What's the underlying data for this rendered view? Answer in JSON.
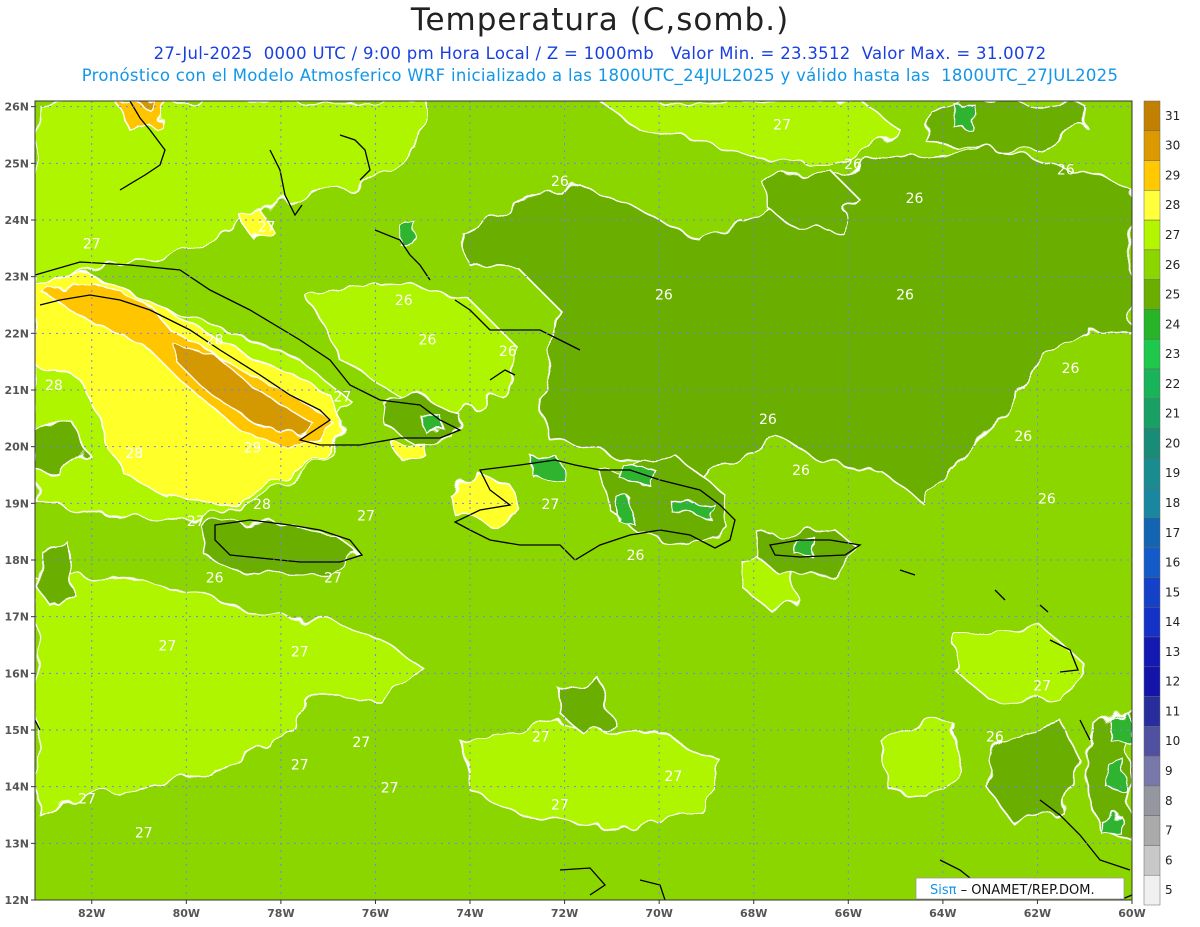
{
  "header": {
    "title": "Temperatura (C,somb.)",
    "line1": "27-Jul-2025  0000 UTC / 9:00 pm Hora Local / Z = 1000mb   Valor Min. = 23.3512  Valor Max. = 31.0072",
    "line2": "Pronóstico con el Modelo Atmosferico WRF inicializado a las 1800UTC_24JUL2025 y válido hasta las  1800UTC_27JUL2025"
  },
  "map": {
    "lon_range": [
      -83.2,
      -60
    ],
    "lat_range": [
      12,
      26.1
    ],
    "lat_ticks": [
      {
        "value": 26,
        "label": "26N"
      },
      {
        "value": 25,
        "label": "25N"
      },
      {
        "value": 24,
        "label": "24N"
      },
      {
        "value": 23,
        "label": "23N"
      },
      {
        "value": 22,
        "label": "22N"
      },
      {
        "value": 21,
        "label": "21N"
      },
      {
        "value": 20,
        "label": "20N"
      },
      {
        "value": 19,
        "label": "19N"
      },
      {
        "value": 18,
        "label": "18N"
      },
      {
        "value": 17,
        "label": "17N"
      },
      {
        "value": 16,
        "label": "16N"
      },
      {
        "value": 15,
        "label": "15N"
      },
      {
        "value": 14,
        "label": "14N"
      },
      {
        "value": 13,
        "label": "13N"
      },
      {
        "value": 12,
        "label": "12N"
      }
    ],
    "lon_ticks": [
      {
        "value": -82,
        "label": "82W"
      },
      {
        "value": -80,
        "label": "80W"
      },
      {
        "value": -78,
        "label": "78W"
      },
      {
        "value": -76,
        "label": "76W"
      },
      {
        "value": -74,
        "label": "74W"
      },
      {
        "value": -72,
        "label": "72W"
      },
      {
        "value": -70,
        "label": "70W"
      },
      {
        "value": -68,
        "label": "68W"
      },
      {
        "value": -66,
        "label": "66W"
      },
      {
        "value": -64,
        "label": "64W"
      },
      {
        "value": -62,
        "label": "62W"
      },
      {
        "value": -60,
        "label": "60W"
      }
    ],
    "fill_colors": {
      "c26": "#8cd600",
      "c25": "#6aaf00",
      "c27": "#aff500",
      "c28": "#ffff29",
      "c29": "#ffc600",
      "c30": "#d49800",
      "c24": "#2db42d"
    },
    "contour_labels": [
      {
        "lon": -67.4,
        "lat": 25.6,
        "text": "27"
      },
      {
        "lon": -72.1,
        "lat": 24.6,
        "text": "26"
      },
      {
        "lon": -65.9,
        "lat": 24.9,
        "text": "26"
      },
      {
        "lon": -64.6,
        "lat": 24.3,
        "text": "26"
      },
      {
        "lon": -61.4,
        "lat": 24.8,
        "text": "26"
      },
      {
        "lon": -78.3,
        "lat": 23.8,
        "text": "27"
      },
      {
        "lon": -82.0,
        "lat": 23.5,
        "text": "27"
      },
      {
        "lon": -75.4,
        "lat": 22.5,
        "text": "26"
      },
      {
        "lon": -69.9,
        "lat": 22.6,
        "text": "26"
      },
      {
        "lon": -64.8,
        "lat": 22.6,
        "text": "26"
      },
      {
        "lon": -74.9,
        "lat": 21.8,
        "text": "26"
      },
      {
        "lon": -73.2,
        "lat": 21.6,
        "text": "26"
      },
      {
        "lon": -79.4,
        "lat": 21.8,
        "text": "28"
      },
      {
        "lon": -82.8,
        "lat": 21.0,
        "text": "28"
      },
      {
        "lon": -61.3,
        "lat": 21.3,
        "text": "26"
      },
      {
        "lon": -76.7,
        "lat": 20.8,
        "text": "27"
      },
      {
        "lon": -67.7,
        "lat": 20.4,
        "text": "26"
      },
      {
        "lon": -81.1,
        "lat": 19.8,
        "text": "28"
      },
      {
        "lon": -78.6,
        "lat": 19.9,
        "text": "29"
      },
      {
        "lon": -62.3,
        "lat": 20.1,
        "text": "26"
      },
      {
        "lon": -67.0,
        "lat": 19.5,
        "text": "26"
      },
      {
        "lon": -78.4,
        "lat": 18.9,
        "text": "28"
      },
      {
        "lon": -76.2,
        "lat": 18.7,
        "text": "27"
      },
      {
        "lon": -72.3,
        "lat": 18.9,
        "text": "27"
      },
      {
        "lon": -61.8,
        "lat": 19.0,
        "text": "26"
      },
      {
        "lon": -79.8,
        "lat": 18.6,
        "text": "27"
      },
      {
        "lon": -70.5,
        "lat": 18.0,
        "text": "26"
      },
      {
        "lon": -79.4,
        "lat": 17.6,
        "text": "26"
      },
      {
        "lon": -76.9,
        "lat": 17.6,
        "text": "27"
      },
      {
        "lon": -80.4,
        "lat": 16.4,
        "text": "27"
      },
      {
        "lon": -77.6,
        "lat": 16.3,
        "text": "27"
      },
      {
        "lon": -61.9,
        "lat": 15.7,
        "text": "27"
      },
      {
        "lon": -76.3,
        "lat": 14.7,
        "text": "27"
      },
      {
        "lon": -72.5,
        "lat": 14.8,
        "text": "27"
      },
      {
        "lon": -62.9,
        "lat": 14.8,
        "text": "26"
      },
      {
        "lon": -77.6,
        "lat": 14.3,
        "text": "27"
      },
      {
        "lon": -69.7,
        "lat": 14.1,
        "text": "27"
      },
      {
        "lon": -75.7,
        "lat": 13.9,
        "text": "27"
      },
      {
        "lon": -82.1,
        "lat": 13.7,
        "text": "27"
      },
      {
        "lon": -72.1,
        "lat": 13.6,
        "text": "27"
      },
      {
        "lon": -80.9,
        "lat": 13.1,
        "text": "27"
      }
    ]
  },
  "colorbar": {
    "levels": [
      "31",
      "30",
      "29",
      "28",
      "27",
      "26",
      "25",
      "24",
      "23",
      "22",
      "21",
      "20",
      "19",
      "18",
      "17",
      "16",
      "15",
      "14",
      "13",
      "12",
      "11",
      "10",
      "9",
      "8",
      "7",
      "6",
      "5"
    ],
    "colors": [
      "#c28000",
      "#dc9a00",
      "#ffc800",
      "#ffff3c",
      "#b4f500",
      "#8cd600",
      "#6aaf00",
      "#28b428",
      "#1ec84b",
      "#19b45a",
      "#19a064",
      "#198c78",
      "#198c91",
      "#1987a0",
      "#1464b4",
      "#145ac8",
      "#1441c8",
      "#1432c8",
      "#1419b4",
      "#1414aa",
      "#282d9b",
      "#5050a0",
      "#7878aa",
      "#9696a0",
      "#aaaaaa",
      "#c8c8c8",
      "#f0f0f0"
    ]
  },
  "credit": {
    "brand": "Sisπ",
    "org": " – ONAMET/REP.DOM."
  }
}
